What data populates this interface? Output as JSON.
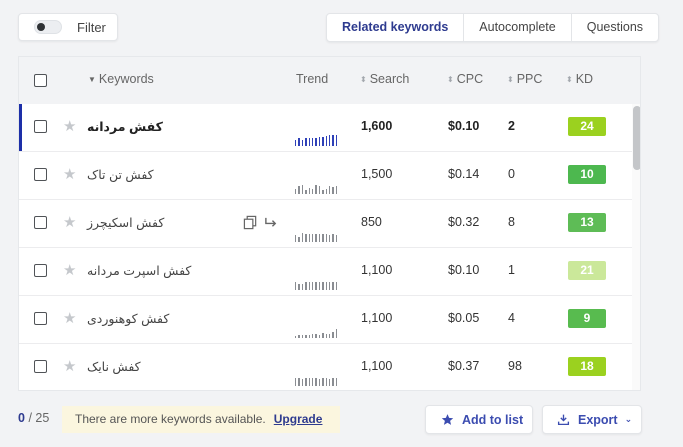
{
  "filter": {
    "label": "Filter"
  },
  "tabs": [
    {
      "label": "Related keywords",
      "active": true
    },
    {
      "label": "Autocomplete",
      "active": false
    },
    {
      "label": "Questions",
      "active": false
    }
  ],
  "table": {
    "headers": {
      "keywords": "Keywords",
      "trend": "Trend",
      "search": "Search",
      "cpc": "CPC",
      "ppc": "PPC",
      "kd": "KD"
    },
    "rows": [
      {
        "keyword": "کفش مردانه",
        "search": "1,600",
        "cpc": "$0.10",
        "ppc": "2",
        "kd": "24",
        "kd_color": "#9bd11f",
        "trend": [
          6,
          8,
          6,
          8,
          8,
          8,
          8,
          9,
          9,
          10,
          11,
          11,
          11
        ],
        "selected": true
      },
      {
        "keyword": "کفش تن تاک",
        "search": "1,500",
        "cpc": "$0.14",
        "ppc": "0",
        "kd": "10",
        "kd_color": "#4db84f",
        "trend": [
          5,
          8,
          9,
          4,
          6,
          5,
          9,
          8,
          4,
          5,
          8,
          7,
          8
        ],
        "selected": false
      },
      {
        "keyword": "کفش اسکیچرز",
        "search": "850",
        "cpc": "$0.32",
        "ppc": "8",
        "kd": "13",
        "kd_color": "#5ebc56",
        "trend": [
          7,
          5,
          9,
          8,
          8,
          8,
          8,
          8,
          8,
          8,
          7,
          8,
          7
        ],
        "selected": false,
        "show_actions": true
      },
      {
        "keyword": "کفش اسپرت مردانه",
        "search": "1,100",
        "cpc": "$0.10",
        "ppc": "1",
        "kd": "21",
        "kd_color": "#cbe89a",
        "trend": [
          8,
          6,
          6,
          8,
          8,
          8,
          8,
          8,
          8,
          8,
          8,
          8,
          8
        ],
        "selected": false
      },
      {
        "keyword": "کفش کوهنوردی",
        "search": "1,100",
        "cpc": "$0.05",
        "ppc": "4",
        "kd": "9",
        "kd_color": "#58bb4f",
        "trend": [
          2,
          3,
          3,
          3,
          3,
          4,
          4,
          3,
          5,
          4,
          4,
          6,
          9
        ],
        "selected": false
      },
      {
        "keyword": "کفش نایک",
        "search": "1,100",
        "cpc": "$0.37",
        "ppc": "98",
        "kd": "18",
        "kd_color": "#9bd11f",
        "trend": [
          8,
          8,
          7,
          8,
          8,
          8,
          8,
          7,
          8,
          8,
          7,
          8,
          8
        ],
        "selected": false
      }
    ]
  },
  "footer": {
    "selected_count": "0",
    "total_label": "/ 25",
    "notice": "There are more keywords available.",
    "upgrade_label": "Upgrade",
    "add_to_list_label": "Add to list",
    "export_label": "Export"
  },
  "icons": {
    "star": "star-icon",
    "sort": "sort-icon",
    "copy": "copy-icon",
    "arrow": "arrow-right-icon",
    "add": "star-icon",
    "export": "download-icon",
    "chevron": "chevron-down-icon"
  },
  "colors": {
    "accent": "#2e3b8f",
    "selected_bar": "#1d2fa8",
    "notice_bg": "#fbf6df"
  }
}
